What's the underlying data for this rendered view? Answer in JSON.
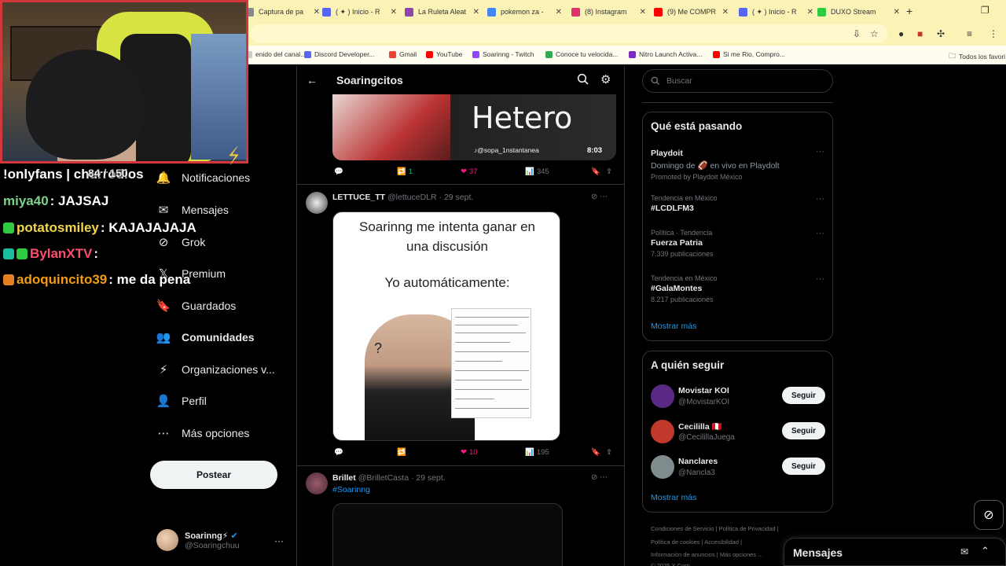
{
  "browser": {
    "tabs": [
      {
        "label": "Captura de pa",
        "color": "#888888"
      },
      {
        "label": "( ✦ ) Inicio - R",
        "color": "#5865f2"
      },
      {
        "label": "La Ruleta Aleat",
        "color": "#8e44ad"
      },
      {
        "label": "pokemon za -",
        "color": "#4285f4"
      },
      {
        "label": "(8) Instagram",
        "color": "#e1306c"
      },
      {
        "label": "(9) Me COMPR",
        "color": "#ff0000"
      },
      {
        "label": "( ✦ ) Inicio - R",
        "color": "#5865f2"
      },
      {
        "label": "DUXO Stream",
        "color": "#2ecc40"
      }
    ],
    "new_tab": "+",
    "bookmarks": [
      {
        "label": "enido del canal...",
        "color": "#cccccc"
      },
      {
        "label": "Discord Developer...",
        "color": "#5865f2"
      },
      {
        "label": "Gmail",
        "color": "#ea4335"
      },
      {
        "label": "YouTube",
        "color": "#ff0000"
      },
      {
        "label": "Soarinng - Twitch",
        "color": "#9146ff"
      },
      {
        "label": "Conoce tu velocida...",
        "color": "#34a853"
      },
      {
        "label": "Nitro Launch Activa...",
        "color": "#7b2cbf"
      },
      {
        "label": "Si me Rio, Compro...",
        "color": "#ff0000"
      }
    ],
    "all_bookmarks": "Todos los favori"
  },
  "stream_overlay": {
    "chat": [
      {
        "user": "!onlyfans | churrodios",
        "text": "",
        "color": "#ffffff"
      },
      {
        "user": "miya40",
        "text": ": JAJSAJ",
        "color": "#7bd389"
      },
      {
        "user": "potatosmiley",
        "text": ": KAJAJAJAJA",
        "color": "#f3d54e"
      },
      {
        "user": "BylanXTV",
        "text": ":",
        "color": "#ff4d6d"
      },
      {
        "user": "adoquincito39",
        "text": ": me da pena",
        "color": "#f39c12"
      }
    ],
    "overlay_counter": "84 / 150"
  },
  "nav": {
    "items": [
      {
        "label": "Notificaciones",
        "icon": "bell-icon",
        "glyph": "🔔",
        "bold": false
      },
      {
        "label": "Mensajes",
        "icon": "envelope-icon",
        "glyph": "✉",
        "bold": false
      },
      {
        "label": "Grok",
        "icon": "grok-icon",
        "glyph": "⊘",
        "bold": false
      },
      {
        "label": "Premium",
        "icon": "x-logo-icon",
        "glyph": "𝕏",
        "bold": false
      },
      {
        "label": "Guardados",
        "icon": "bookmark-icon",
        "glyph": "🔖",
        "bold": false
      },
      {
        "label": "Comunidades",
        "icon": "communities-icon",
        "glyph": "👥",
        "bold": true
      },
      {
        "label": "Organizaciones v...",
        "icon": "lightning-icon",
        "glyph": "⚡",
        "bold": false
      },
      {
        "label": "Perfil",
        "icon": "person-icon",
        "glyph": "👤",
        "bold": false
      },
      {
        "label": "Más opciones",
        "icon": "more-circle-icon",
        "glyph": "⋯",
        "bold": false
      }
    ],
    "post_button": "Postear",
    "account": {
      "name": "Soarinng⚡",
      "handle": "@Soaringchuu",
      "more": "···"
    }
  },
  "center": {
    "title": "Soaringcitos",
    "back": "←",
    "tweet1": {
      "media_text": "Hetero",
      "media_source": "♪@sopa_1nstantanea",
      "duration": "8:03",
      "replies": "",
      "retweets": "1",
      "likes": "37",
      "views": "345"
    },
    "tweet2": {
      "name": "LETTUCE_TT",
      "meta": "@lettuceDLR · 29 sept.",
      "meme_line1": "Soarinng me intenta ganar en",
      "meme_line2": "una discusión",
      "meme_line3": "Yo automáticamente:",
      "meme_q": "?",
      "likes": "10",
      "views": "195"
    },
    "tweet3": {
      "name": "Brillet",
      "meta": "@BrilletCasta · 29 sept.",
      "hashtag": "#Soarinng"
    }
  },
  "right": {
    "search_placeholder": "Buscar",
    "trends_title": "Qué está pasando",
    "trends": [
      {
        "ctx": "",
        "name": "Playdoit",
        "sub": "Domingo de 🏈 en vivo en Playdolt",
        "sub2": "Promoted by Playdoit México"
      },
      {
        "ctx": "Tendencia en México",
        "name": "#LCDLFM3",
        "sub": "",
        "sub2": ""
      },
      {
        "ctx": "Política · Tendencia",
        "name": "Fuerza Patria",
        "sub": "7.339 publicaciones",
        "sub2": ""
      },
      {
        "ctx": "Tendencia en México",
        "name": "#GalaMontes",
        "sub": "8.217 publicaciones",
        "sub2": ""
      }
    ],
    "trends_more": "Mostrar más",
    "follow_title": "A quién seguir",
    "follows": [
      {
        "name": "Movistar KOI",
        "handle": "@MovistarKOI",
        "button": "Seguir",
        "color": "#5b2a86"
      },
      {
        "name": "Cecililla 🇵🇪",
        "handle": "@CecilillaJuega",
        "button": "Seguir",
        "color": "#c0392b"
      },
      {
        "name": "Nanclares",
        "handle": "@Nancla3",
        "button": "Seguir",
        "color": "#7f8c8d"
      }
    ],
    "follow_more": "Mostrar más",
    "footer": [
      "Condiciones de Servicio  |  Política de Privacidad  |",
      "Política de cookies  |  Accesibilidad  |",
      "Información de anuncios  |  Más opciones ...",
      "© 2025 X Corp."
    ],
    "messages_title": "Mensajes"
  }
}
